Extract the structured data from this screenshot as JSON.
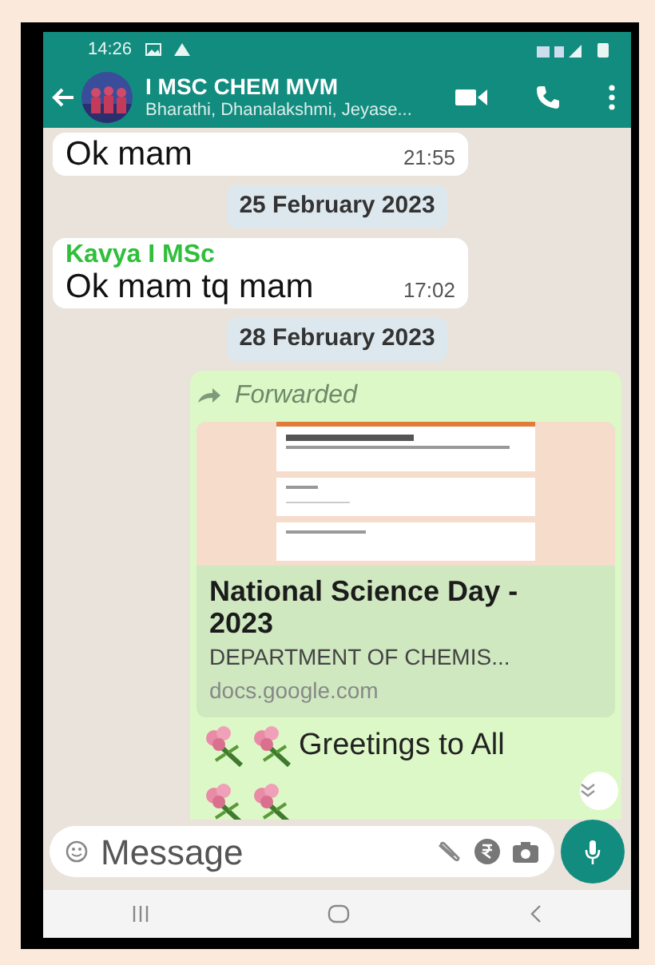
{
  "status_bar": {
    "time": "14:26"
  },
  "header": {
    "title": "I MSC CHEM MVM",
    "subtitle": "Bharathi, Dhanalakshmi, Jeyase..."
  },
  "messages": [
    {
      "kind": "incoming",
      "text": "Ok mam",
      "time": "21:55"
    },
    {
      "kind": "date",
      "text": "25 February 2023"
    },
    {
      "kind": "incoming",
      "sender": "Kavya I MSc",
      "text": "Ok mam tq mam",
      "time": "17:02"
    },
    {
      "kind": "date",
      "text": "28 February 2023"
    },
    {
      "kind": "forwarded",
      "label": "Forwarded",
      "preview": {
        "kind": "picture",
        "title": "National Science Day - 2023",
        "description": "DEPARTMENT OF CHEMIS...",
        "domain": "docs.google.com"
      },
      "text": "Greetings to All"
    }
  ],
  "composer": {
    "placeholder": "Message"
  }
}
